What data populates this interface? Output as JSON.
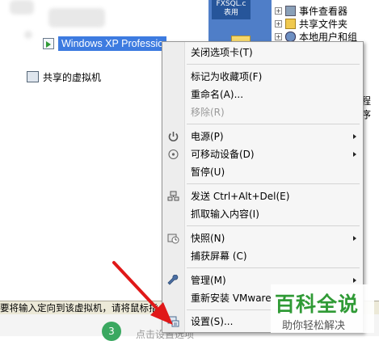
{
  "tree": {
    "vm_selected": "Windows XP Professio",
    "shared": "共享的虚拟机"
  },
  "xp_panel": {
    "title": "FXSQL.c\n表用"
  },
  "right_tree": {
    "items": [
      "事件查看器",
      "共享文件夹",
      "本地用户和组"
    ],
    "partial": "程序"
  },
  "context_menu": {
    "close_tab": "关闭选项卡(T)",
    "bookmark": "标记为收藏项(F)",
    "rename": "重命名(A)...",
    "remove": "移除(R)",
    "power": "电源(P)",
    "removable": "可移动设备(D)",
    "pause": "暂停(U)",
    "send_cad": "发送 Ctrl+Alt+Del(E)",
    "grab_input": "抓取输入内容(I)",
    "snapshot": "快照(N)",
    "capture": "捕获屏幕 (C)",
    "manage": "管理(M)",
    "reinstall": "重新安装 VMware",
    "settings": "设置(S)..."
  },
  "status_bar": {
    "text": "要将输入定向到该虚拟机，请将鼠标指"
  },
  "bottom": {
    "step": "3",
    "text": "点击设置选项"
  },
  "watermark": {
    "logo": "百科全说",
    "sub": "助你轻松解决"
  },
  "colors": {
    "selection": "#3d7be0",
    "arrow": "#e01818",
    "xp_blue": "#4f7ec8",
    "logo_green": "#2f9a35"
  }
}
